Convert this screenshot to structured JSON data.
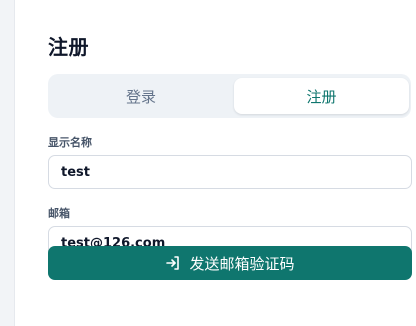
{
  "page": {
    "title": "注册"
  },
  "tabs": [
    {
      "label": "登录"
    },
    {
      "label": "注册"
    }
  ],
  "form": {
    "display_name": {
      "label": "显示名称",
      "value": "test"
    },
    "email": {
      "label": "邮箱",
      "value": "test@126.com"
    },
    "submit_label": "发送邮箱验证码"
  },
  "colors": {
    "accent": "#0f766e",
    "active_tab_text": "#0f766e",
    "inactive_tab_text": "#64748b"
  },
  "icons": {
    "submit": "login-arrow-icon"
  }
}
